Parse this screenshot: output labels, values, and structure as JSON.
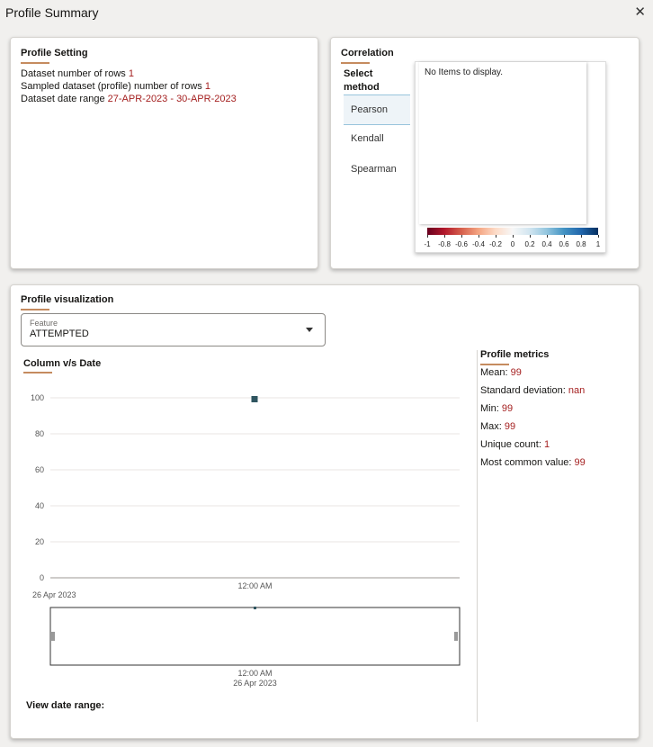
{
  "window": {
    "title": "Profile Summary",
    "close_icon": "close-icon"
  },
  "profile_setting": {
    "title": "Profile Setting",
    "rows_label": "Dataset number of rows",
    "rows_value": "1",
    "sampled_label": "Sampled dataset (profile) number of rows",
    "sampled_value": "1",
    "date_range_label": "Dataset date range",
    "date_range_value": "27-APR-2023 - 30-APR-2023"
  },
  "correlation": {
    "title": "Correlation",
    "select_method_label_1": "Select",
    "select_method_label_2": "method",
    "methods": [
      "Pearson",
      "Kendall",
      "Spearman"
    ],
    "selected_method": "Pearson",
    "empty_message": "No Items to display.",
    "colorbar_ticks": [
      "-1",
      "-0.8",
      "-0.6",
      "-0.4",
      "-0.2",
      "0",
      "0.2",
      "0.4",
      "0.6",
      "0.8",
      "1"
    ],
    "colorbar_colors": [
      "#67001f",
      "#f7f7f7",
      "#053061"
    ]
  },
  "profile_visualization": {
    "title": "Profile visualization",
    "feature_select": {
      "label": "Feature",
      "value": "ATTEMPTED"
    },
    "chart_title": "Column v/s Date",
    "view_date_range_label": "View date range:"
  },
  "chart_data": {
    "type": "scatter",
    "title": "Column v/s Date",
    "xlabel": "",
    "ylabel": "",
    "ylim": [
      0,
      100
    ],
    "y_ticks": [
      "0",
      "20",
      "40",
      "60",
      "80",
      "100"
    ],
    "x_tick_labels": [
      "12:00 AM"
    ],
    "x_start_label": "26 Apr 2023",
    "points": [
      {
        "x": "12:00 AM 26 Apr 2023",
        "y": 99
      }
    ],
    "marker_color": "#2f5560",
    "grid": true,
    "overview": {
      "x_tick_time": "12:00 AM",
      "x_tick_date": "26 Apr 2023"
    }
  },
  "profile_metrics": {
    "title": "Profile metrics",
    "items": [
      {
        "label": "Mean:",
        "value": "99"
      },
      {
        "label": "Standard deviation:",
        "value": "nan"
      },
      {
        "label": "Min:",
        "value": "99"
      },
      {
        "label": "Max:",
        "value": "99"
      },
      {
        "label": "Unique count:",
        "value": "1"
      },
      {
        "label": "Most common value:",
        "value": "99"
      }
    ]
  },
  "colors": {
    "accent_underline": "#c58b5f",
    "value_red": "#a41f1f",
    "selected_bg": "#eef4f8"
  }
}
